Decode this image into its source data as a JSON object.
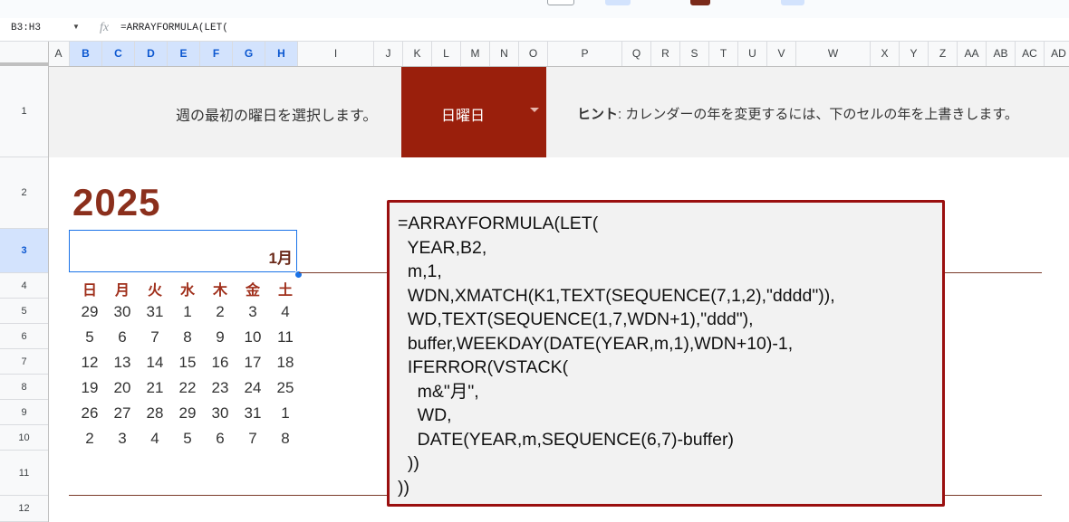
{
  "formula_bar": {
    "namebox": "B3:H3",
    "fx_icon": "fx",
    "content": "=ARRAYFORMULA(LET("
  },
  "columns": [
    "A",
    "B",
    "C",
    "D",
    "E",
    "F",
    "G",
    "H",
    "I",
    "J",
    "K",
    "L",
    "M",
    "N",
    "O",
    "P",
    "Q",
    "R",
    "S",
    "T",
    "U",
    "V",
    "W",
    "X",
    "Y",
    "Z",
    "AA",
    "AB",
    "AC",
    "AD"
  ],
  "selected_columns": [
    "B",
    "C",
    "D",
    "E",
    "F",
    "G",
    "H"
  ],
  "rows": [
    "1",
    "2",
    "3",
    "4",
    "5",
    "6",
    "7",
    "8",
    "9",
    "10",
    "11",
    "12"
  ],
  "selected_row": "3",
  "banner": {
    "instruction": "週の最初の曜日を選択します。",
    "dropdown_value": "日曜日",
    "hint_label": "ヒント",
    "hint_text": ": カレンダーの年を変更するには、下のセルの年を上書きします。"
  },
  "calendar": {
    "year": "2025",
    "month": "1月",
    "weekdays": [
      "日",
      "月",
      "火",
      "水",
      "木",
      "金",
      "土"
    ],
    "weeks": [
      [
        "29",
        "30",
        "31",
        "1",
        "2",
        "3",
        "4"
      ],
      [
        "5",
        "6",
        "7",
        "8",
        "9",
        "10",
        "11"
      ],
      [
        "12",
        "13",
        "14",
        "15",
        "16",
        "17",
        "18"
      ],
      [
        "19",
        "20",
        "21",
        "22",
        "23",
        "24",
        "25"
      ],
      [
        "26",
        "27",
        "28",
        "29",
        "30",
        "31",
        "1"
      ],
      [
        "2",
        "3",
        "4",
        "5",
        "6",
        "7",
        "8"
      ]
    ]
  },
  "formula_box": {
    "text": "=ARRAYFORMULA(LET(\n  YEAR,B2,\n  m,1,\n  WDN,XMATCH(K1,TEXT(SEQUENCE(7,1,2),\"dddd\")),\n  WD,TEXT(SEQUENCE(1,7,WDN+1),\"ddd\"),\n  buffer,WEEKDAY(DATE(YEAR,m,1),WDN+10)-1,\n  IFERROR(VSTACK(\n    m&\"月\",\n    WD,\n    DATE(YEAR,m,SEQUENCE(6,7)-buffer)\n  ))\n))"
  },
  "colors": {
    "accent": "#9a1f0c",
    "year": "#8b2f1c",
    "selection": "#1a73e8",
    "formula_border": "#9a0f0f"
  }
}
